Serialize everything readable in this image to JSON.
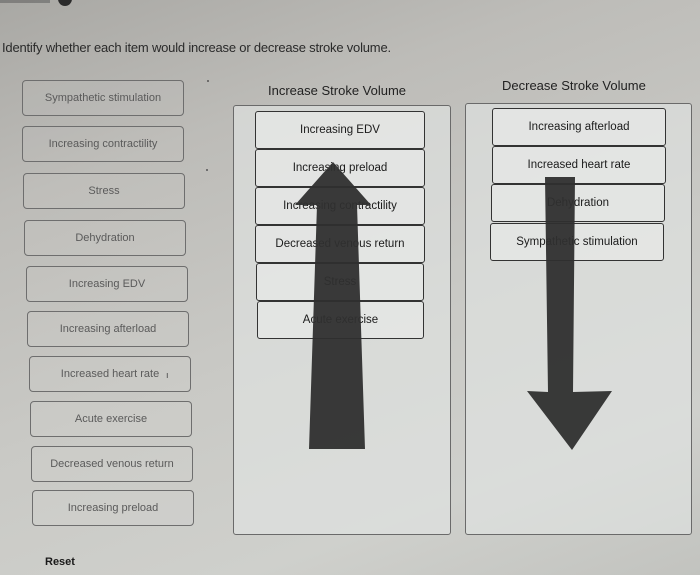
{
  "instruction": "Identify whether each item would increase or decrease stroke volume.",
  "source_items": [
    {
      "label": "Sympathetic stimulation"
    },
    {
      "label": "Increasing contractility"
    },
    {
      "label": "Stress"
    },
    {
      "label": "Dehydration"
    },
    {
      "label": "Increasing EDV"
    },
    {
      "label": "Increasing afterload"
    },
    {
      "label": "Increased heart rate"
    },
    {
      "label": "Acute exercise"
    },
    {
      "label": "Decreased venous return"
    },
    {
      "label": "Increasing preload"
    }
  ],
  "bins": {
    "increase": {
      "title": "Increase Stroke Volume",
      "arrow_icon": "up-arrow-icon",
      "items": [
        {
          "label": "Increasing EDV"
        },
        {
          "label": "Increasing preload"
        },
        {
          "label": "Increasing contractility"
        },
        {
          "label": "Decreased venous return"
        },
        {
          "label": "Stress"
        },
        {
          "label": "Acute exercise"
        }
      ]
    },
    "decrease": {
      "title": "Decrease Stroke Volume",
      "arrow_icon": "down-arrow-icon",
      "items": [
        {
          "label": "Increasing afterload"
        },
        {
          "label": "Increased heart rate"
        },
        {
          "label": "Dehydration"
        },
        {
          "label": "Sympathetic stimulation"
        }
      ]
    }
  },
  "reset_label": "Reset",
  "colors": {
    "arrow": "#2f2f2f",
    "card_border": "#6e6e6e",
    "placed_border": "#333333"
  }
}
